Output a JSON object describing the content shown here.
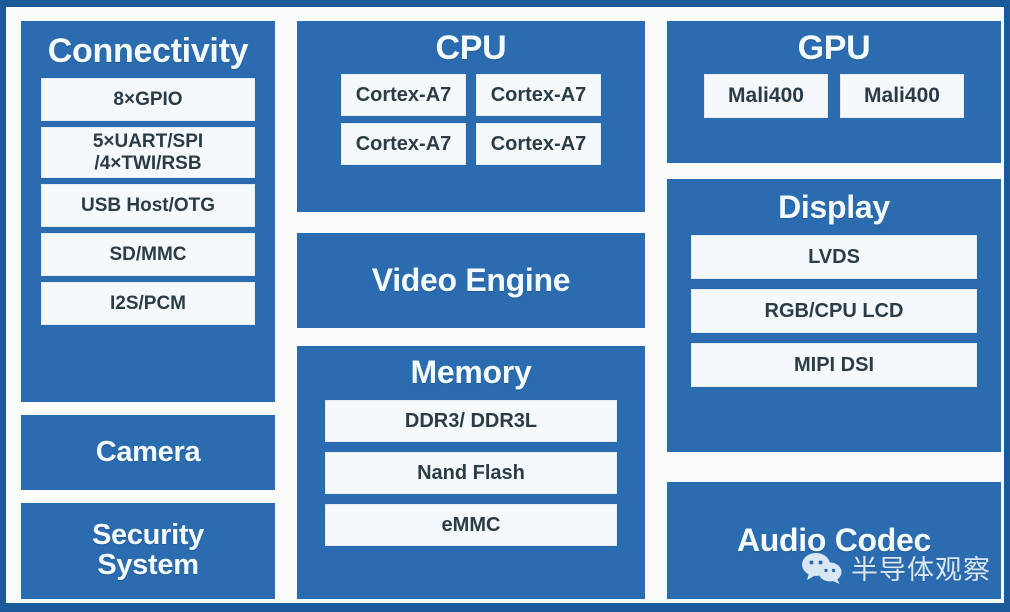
{
  "diagram": {
    "title": "SoC Block Diagram",
    "colors": {
      "block_blue": "#2b6cb0",
      "border_blue": "#1b5a98",
      "sub_box": "#f5f9fb",
      "sub_text": "#2c3c47",
      "block_text": "#f4fbff"
    }
  },
  "blocks": {
    "connectivity": {
      "title": "Connectivity",
      "items": [
        {
          "label": "8×GPIO"
        },
        {
          "label": "5×UART/SPI\n/4×TWI/RSB"
        },
        {
          "label": "USB Host/OTG"
        },
        {
          "label": "SD/MMC"
        },
        {
          "label": "I2S/PCM"
        }
      ]
    },
    "camera": {
      "title": "Camera"
    },
    "security": {
      "title": "Security\nSystem"
    },
    "cpu": {
      "title": "CPU",
      "cores": [
        {
          "label": "Cortex-A7"
        },
        {
          "label": "Cortex-A7"
        },
        {
          "label": "Cortex-A7"
        },
        {
          "label": "Cortex-A7"
        }
      ]
    },
    "video_engine": {
      "title": "Video Engine"
    },
    "memory": {
      "title": "Memory",
      "items": [
        {
          "label": "DDR3/ DDR3L"
        },
        {
          "label": "Nand Flash"
        },
        {
          "label": "eMMC"
        }
      ]
    },
    "gpu": {
      "title": "GPU",
      "items": [
        {
          "label": "Mali400"
        },
        {
          "label": "Mali400"
        }
      ]
    },
    "display": {
      "title": "Display",
      "items": [
        {
          "label": "LVDS"
        },
        {
          "label": "RGB/CPU LCD"
        },
        {
          "label": "MIPI DSI"
        }
      ]
    },
    "audio_codec": {
      "title": "Audio Codec"
    }
  },
  "watermark": {
    "icon": "wechat-icon",
    "text": "半导体观察"
  }
}
